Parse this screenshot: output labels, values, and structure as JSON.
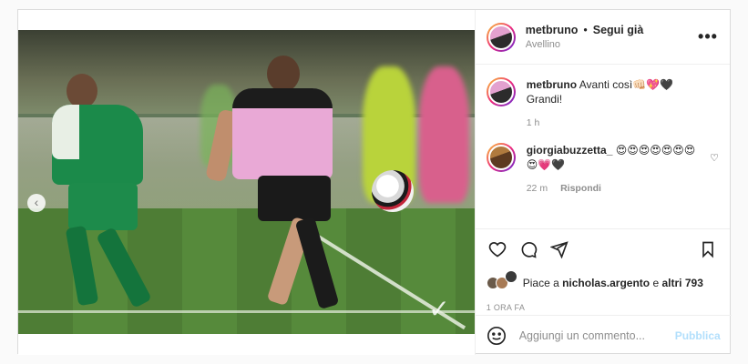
{
  "post": {
    "username": "metbruno",
    "separator": "•",
    "follow_label": "Segui già",
    "location": "Avellino",
    "more_label": "•••"
  },
  "comments": [
    {
      "username": "metbruno",
      "text": "Avanti così👊🏻💖🖤",
      "text2": "Grandi!",
      "time": "1 h"
    },
    {
      "username": "giorgiabuzzetta_",
      "text": "😍😍😍😍😍😍😍",
      "text2": "😍💗🖤",
      "time": "22 m",
      "reply_label": "Rispondi"
    }
  ],
  "likes": {
    "prefix": "Piace a",
    "user": "nicholas.argento",
    "conj": "e",
    "others": "altri 793"
  },
  "posted_time": "1 ORA FA",
  "add_comment": {
    "placeholder": "Aggiungi un commento...",
    "publish_label": "Pubblica"
  },
  "media": {
    "prev_label": "‹"
  },
  "icons": {
    "like": "heart-icon",
    "comment": "comment-icon",
    "share": "send-icon",
    "save": "bookmark-icon",
    "emoji": "smiley-icon"
  },
  "colors": {
    "publish_disabled": "#b2dffc",
    "secondary_text": "#8e8e8e",
    "border": "#dbdbdb"
  }
}
